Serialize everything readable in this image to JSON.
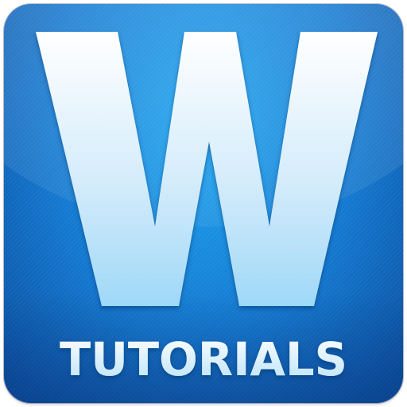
{
  "icon": {
    "letter": "W",
    "word": "TUTORIALS"
  },
  "colors": {
    "background_light": "#1ea6f2",
    "background_mid": "#1478cf",
    "background_dark": "#0a4d9e",
    "letter_top": "#ffffff",
    "letter_bottom": "#9fd8f7"
  }
}
